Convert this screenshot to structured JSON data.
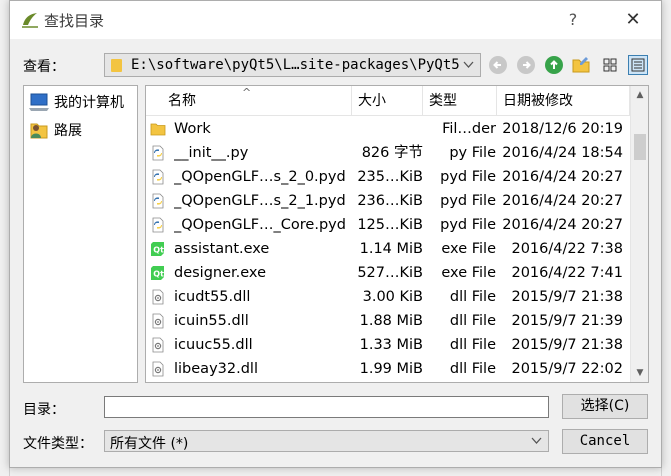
{
  "window": {
    "title": "查找目录",
    "help": "?",
    "close": "✕"
  },
  "lookin": {
    "label": "查看：",
    "path": "E:\\software\\pyQt5\\L…site-packages\\PyQt5"
  },
  "places": [
    {
      "label": "我的计算机",
      "icon": "computer-icon"
    },
    {
      "label": "路展",
      "icon": "user-folder-icon"
    }
  ],
  "columns": [
    "名称",
    "大小",
    "类型",
    "日期被修改"
  ],
  "files": [
    {
      "name": "Work",
      "size": "",
      "type": "Fil…der",
      "date": "2018/12/6 20:19",
      "icon": "folder-icon"
    },
    {
      "name": "__init__.py",
      "size": "826 字节",
      "type": "py File",
      "date": "2016/4/24 18:54",
      "icon": "python-file-icon"
    },
    {
      "name": "_QOpenGLF…s_2_0.pyd",
      "size": "235…KiB",
      "type": "pyd File",
      "date": "2016/4/24 20:27",
      "icon": "python-file-icon"
    },
    {
      "name": "_QOpenGLF…s_2_1.pyd",
      "size": "236…KiB",
      "type": "pyd File",
      "date": "2016/4/24 20:27",
      "icon": "python-file-icon"
    },
    {
      "name": "_QOpenGLF…_Core.pyd",
      "size": "125…KiB",
      "type": "pyd File",
      "date": "2016/4/24 20:27",
      "icon": "python-file-icon"
    },
    {
      "name": "assistant.exe",
      "size": "1.14 MiB",
      "type": "exe File",
      "date": "2016/4/22 7:38",
      "icon": "qt-exe-icon"
    },
    {
      "name": "designer.exe",
      "size": "527…KiB",
      "type": "exe File",
      "date": "2016/4/22 7:41",
      "icon": "qt-exe-icon"
    },
    {
      "name": "icudt55.dll",
      "size": "3.00 KiB",
      "type": "dll File",
      "date": "2015/9/7 21:38",
      "icon": "dll-file-icon"
    },
    {
      "name": "icuin55.dll",
      "size": "1.88 MiB",
      "type": "dll File",
      "date": "2015/9/7 21:39",
      "icon": "dll-file-icon"
    },
    {
      "name": "icuuc55.dll",
      "size": "1.33 MiB",
      "type": "dll File",
      "date": "2015/9/7 21:38",
      "icon": "dll-file-icon"
    },
    {
      "name": "libeay32.dll",
      "size": "1.99 MiB",
      "type": "dll File",
      "date": "2015/9/7 22:02",
      "icon": "dll-file-icon"
    }
  ],
  "filename": {
    "label": "目录：",
    "value": ""
  },
  "filetype": {
    "label": "文件类型：",
    "value": "所有文件 (*)"
  },
  "buttons": {
    "open": "选择(C)",
    "cancel": "Cancel"
  },
  "colors": {
    "folder": "#f3c441",
    "python_blue": "#3a75b0",
    "python_yellow": "#f7d04a",
    "qt_green": "#41cd52",
    "nav_green": "#37a34a"
  }
}
